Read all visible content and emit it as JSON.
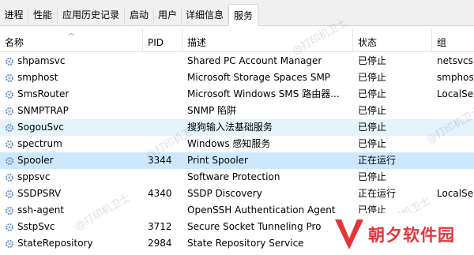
{
  "tabs": [
    "进程",
    "性能",
    "应用历史记录",
    "启动",
    "用户",
    "详细信息",
    "服务"
  ],
  "active_tab": "服务",
  "columns": {
    "name": "名称",
    "pid": "PID",
    "desc": "描述",
    "state": "状态",
    "group": "组"
  },
  "rows": [
    {
      "name": "shpamsvc",
      "pid": "",
      "desc": "Shared PC Account Manager",
      "state": "已停止",
      "group": "netsvcs"
    },
    {
      "name": "smphost",
      "pid": "",
      "desc": "Microsoft Storage Spaces SMP",
      "state": "已停止",
      "group": "smphost"
    },
    {
      "name": "SmsRouter",
      "pid": "",
      "desc": "Microsoft Windows SMS 路由器...",
      "state": "已停止",
      "group": "LocalSer"
    },
    {
      "name": "SNMPTRAP",
      "pid": "",
      "desc": "SNMP 陷阱",
      "state": "已停止",
      "group": ""
    },
    {
      "name": "SogouSvc",
      "pid": "",
      "desc": "搜狗输入法基础服务",
      "state": "已停止",
      "group": ""
    },
    {
      "name": "spectrum",
      "pid": "",
      "desc": "Windows 感知服务",
      "state": "已停止",
      "group": ""
    },
    {
      "name": "Spooler",
      "pid": "3344",
      "desc": "Print Spooler",
      "state": "正在运行",
      "group": ""
    },
    {
      "name": "sppsvc",
      "pid": "",
      "desc": "Software Protection",
      "state": "已停止",
      "group": ""
    },
    {
      "name": "SSDPSRV",
      "pid": "4340",
      "desc": "SSDP Discovery",
      "state": "正在运行",
      "group": "LocalSer"
    },
    {
      "name": "ssh-agent",
      "pid": "",
      "desc": "OpenSSH Authentication Agent",
      "state": "已停止",
      "group": ""
    },
    {
      "name": "SstpSvc",
      "pid": "3712",
      "desc": "Secure Socket Tunneling Pro",
      "state": "正在运行",
      "group": ""
    },
    {
      "name": "StateRepository",
      "pid": "2984",
      "desc": "State Repository Service",
      "state": "正在运行",
      "group": ""
    }
  ],
  "watermark": "@打印机卫士",
  "logo": {
    "text": "朝夕软件园"
  },
  "colors": {
    "hover_row": "#e5f3fb",
    "selected_row": "#cce8ff",
    "logo_red": "#e8333a"
  },
  "icons": {
    "service": "gear-icon",
    "sort": "sort-ascending-icon"
  }
}
